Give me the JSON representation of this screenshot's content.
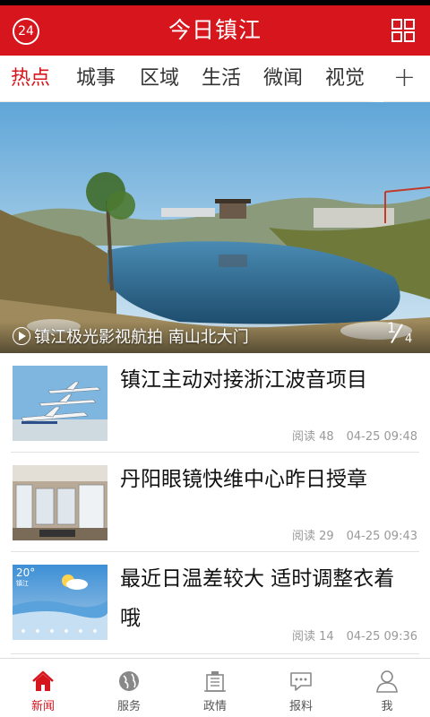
{
  "header": {
    "badge_text": "24",
    "title": "今日镇江"
  },
  "tabs": [
    {
      "label": "热点",
      "active": true
    },
    {
      "label": "城事"
    },
    {
      "label": "区域"
    },
    {
      "label": "生活"
    },
    {
      "label": "微闻"
    },
    {
      "label": "视觉"
    }
  ],
  "tabs_more_symbol": "+",
  "banner": {
    "caption": "镇江极光影视航拍 南山北大门",
    "page_current": "1",
    "page_total": "4"
  },
  "news": [
    {
      "headline": "镇江主动对接浙江波音项目",
      "reads": "阅读 48",
      "time": "04-25 09:48",
      "thumb": "airplane-image"
    },
    {
      "headline": "丹阳眼镜快维中心昨日授章",
      "reads": "阅读 29",
      "time": "04-25 09:43",
      "thumb": "store-interior-image"
    },
    {
      "headline": "最近日温差较大 适时调整衣着哦",
      "reads": "阅读 14",
      "time": "04-25 09:36",
      "thumb": "weather-app-image"
    }
  ],
  "weather_thumb": {
    "temp": "20°",
    "city": "镇江"
  },
  "bottom_nav": [
    {
      "label": "新闻",
      "icon": "home-icon",
      "active": true
    },
    {
      "label": "服务",
      "icon": "globe-icon"
    },
    {
      "label": "政情",
      "icon": "building-icon"
    },
    {
      "label": "报料",
      "icon": "chat-bubble-icon"
    },
    {
      "label": "我",
      "icon": "user-icon"
    }
  ],
  "colors": {
    "brand_red": "#d7151c"
  }
}
